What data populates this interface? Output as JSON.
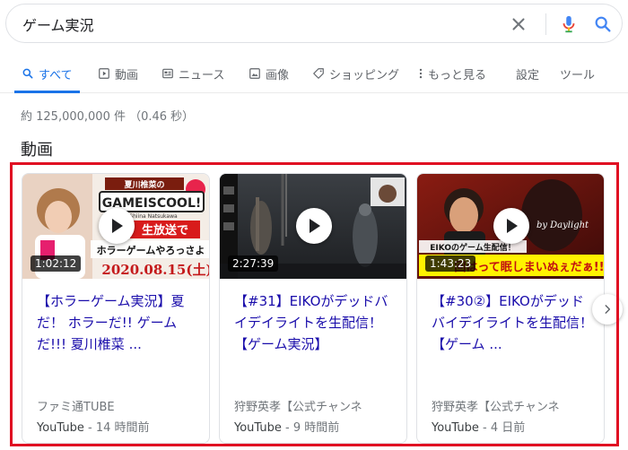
{
  "search": {
    "query": "ゲーム実況"
  },
  "tabs": [
    {
      "label": "すべて",
      "icon": "search-icon",
      "active": true
    },
    {
      "label": "動画",
      "icon": "video-icon"
    },
    {
      "label": "ニュース",
      "icon": "news-icon"
    },
    {
      "label": "画像",
      "icon": "image-icon"
    },
    {
      "label": "ショッピング",
      "icon": "tag-icon"
    },
    {
      "label": "もっと見る",
      "icon": "more-vert-icon"
    },
    {
      "label": "設定"
    },
    {
      "label": "ツール"
    }
  ],
  "result_stats": "約 125,000,000 件 （0.46 秒）",
  "section": {
    "title": "動画"
  },
  "videos": [
    {
      "title": "【ホラーゲーム実況】夏だ！ ホラーだ!! ゲームだ!!! 夏川椎菜 ...",
      "duration": "1:02:12",
      "channel": "ファミ通TUBE",
      "source": "YouTube",
      "time": "14 時間前",
      "thumb_text": {
        "banner": "夏川椎菜の",
        "logo": "GAMEISCOOL!",
        "subtitle": "Shiina Natsukawa",
        "line1": "生放送で",
        "line2": "ホラーゲームやろっさよ",
        "date": "2020.08.15(土)"
      }
    },
    {
      "title": "【#31】EIKOがデッドバイデイライトを生配信！【ゲーム実況】",
      "duration": "2:27:39",
      "channel": "狩野英孝【公式チャンネ",
      "source": "YouTube",
      "time": "9 時間前"
    },
    {
      "title": "【#30②】EIKOがデッドバイデイライトを生配信！【ゲーム ...",
      "duration": "1:43:23",
      "channel": "狩野英孝【公式チャンネ",
      "source": "YouTube",
      "time": "4 日前",
      "thumb_text": {
        "logo": "by Daylight",
        "caption": "EIKOのゲーム生配信！",
        "big": "回はって眠しまいぬぇだぁ!!"
      }
    }
  ],
  "colors": {
    "accent": "#1a73e8",
    "link": "#1a0dab",
    "highlight": "#e00d22"
  }
}
